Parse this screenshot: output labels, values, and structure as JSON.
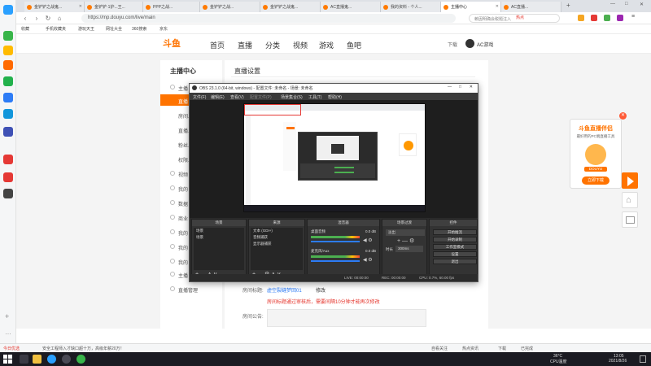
{
  "browser": {
    "tabs": [
      {
        "label": "金铲铲之战鬼..."
      },
      {
        "label": "金铲铲·1护...王..."
      },
      {
        "label": "PPP之战..."
      },
      {
        "label": "金铲铲之战..."
      },
      {
        "label": "金铲铲之战鬼..."
      },
      {
        "label": "AC直播鬼..."
      },
      {
        "label": "我的资料 - 个人..."
      },
      {
        "label": "主播中心"
      },
      {
        "label": "AC直播..."
      }
    ],
    "active_tab_label": "主播中心",
    "url": "https://mp.douyu.com/live/main",
    "search_placeholder": "赖因明确会税题注入",
    "hot_word": "热点",
    "bookmarks": [
      "收藏",
      "手机收藏夹",
      "游玩天王",
      "网址大全",
      "360搜索",
      "京东"
    ]
  },
  "douyu": {
    "logo_text": "斗鱼",
    "nav": [
      "首页",
      "直播",
      "分类",
      "视频",
      "游戏",
      "鱼吧"
    ],
    "download": "下载",
    "username": "AC游戏"
  },
  "sidebar": {
    "title": "主播中心",
    "items": [
      "主播",
      "直播",
      "房间...",
      "直播...",
      "粉丝...",
      "权限...",
      "视频",
      "我的",
      "数据",
      "商业",
      "我的",
      "我的",
      "我的",
      "主播",
      "直播管理"
    ]
  },
  "main": {
    "section_title": "直播设置",
    "room_title_label": "房间标题:",
    "room_title_value": "虚空裂缝梦回01",
    "edit_label": "修改",
    "title_hint": "房间标题通过审核后，需要间隔10分钟才能再次修改",
    "announcement_label": "房间公告:"
  },
  "obs": {
    "title": "OBS 23.1.0 (64-bit, windows) - 配置文件: 未命名 - 场景: 未命名",
    "menu": [
      "文件(F)",
      "编辑(E)",
      "查看(V)",
      "配置文件(P)",
      "场景集合(S)",
      "工具(T)",
      "帮助(H)"
    ],
    "docks": {
      "scenes": {
        "title": "场景",
        "items": [
          "场景",
          "场景"
        ]
      },
      "sources": {
        "title": "来源",
        "items": [
          "文本 (GDI+)",
          "音频捕获",
          "显示器捕获"
        ]
      },
      "mixer": {
        "title": "混音器",
        "tracks": [
          {
            "name": "桌面音频",
            "db": "0.0 dB"
          },
          {
            "name": "麦克风/Aux",
            "db": "0.0 dB"
          }
        ]
      },
      "transitions": {
        "title": "场景过渡",
        "type": "淡出",
        "duration_label": "时长",
        "duration": "300ms"
      },
      "controls": {
        "title": "控件",
        "buttons": [
          "开始推流",
          "开始录制",
          "工作室模式",
          "设置",
          "退出"
        ]
      }
    },
    "status": {
      "live": "LIVE: 00:00:00",
      "rec": "REC: 00:00:00",
      "cpu": "CPU: 0.7%, 60.00 fps"
    }
  },
  "ad": {
    "title": "斗鱼直播伴侣",
    "subtitle": "最好用的PC端直播工具",
    "button": "立即下载",
    "brand": "DOUYU"
  },
  "statusbar": {
    "left": "今日优选",
    "news": "安全工程师入才缺口超十万，高级年薪20万！",
    "items": [
      "自看关注",
      "热点资讯",
      "下载",
      "已完成"
    ]
  },
  "taskbar": {
    "weather": "36°C",
    "cpu_temp": "CPU温度",
    "time": "13:05",
    "date": "2021/8/26"
  },
  "colors": {
    "brand_orange": "#ff7300",
    "obs_dark": "#2b2b2b",
    "red_hint": "#e5342b"
  }
}
